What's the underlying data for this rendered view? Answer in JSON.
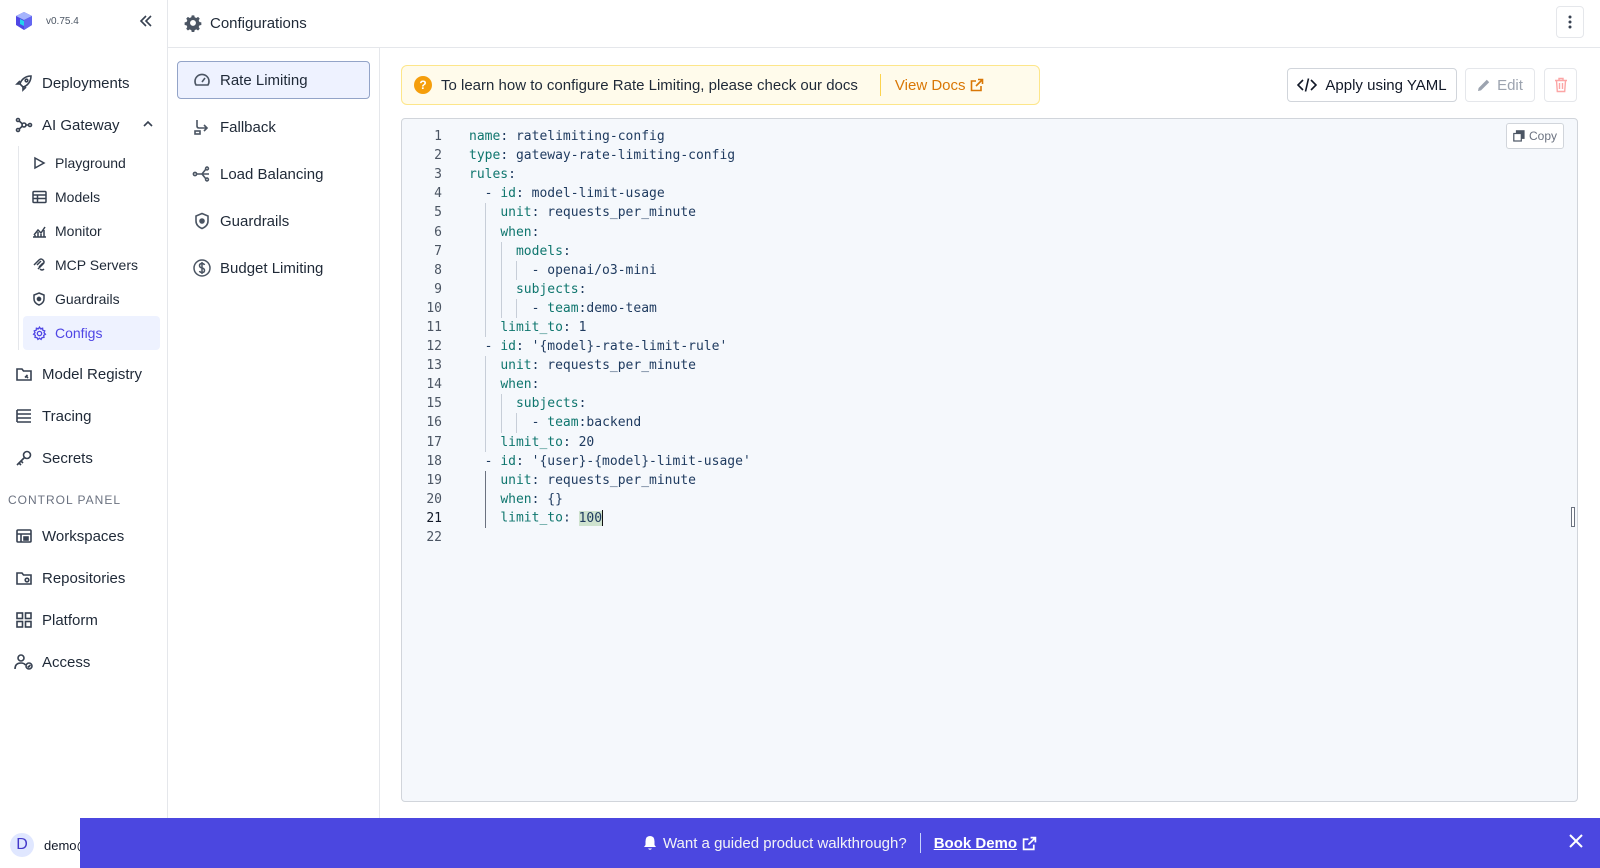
{
  "app": {
    "version": "v0.75.4"
  },
  "header": {
    "title": "Configurations"
  },
  "sidebar": {
    "top_items": [
      {
        "label": "Deployments"
      },
      {
        "label": "AI Gateway"
      }
    ],
    "ai_gateway_children": [
      {
        "label": "Playground"
      },
      {
        "label": "Models"
      },
      {
        "label": "Monitor"
      },
      {
        "label": "MCP Servers"
      },
      {
        "label": "Guardrails"
      },
      {
        "label": "Configs",
        "active": true
      }
    ],
    "mid_items": [
      {
        "label": "Model Registry"
      },
      {
        "label": "Tracing"
      },
      {
        "label": "Secrets"
      }
    ],
    "control_panel_title": "CONTROL PANEL",
    "control_items": [
      {
        "label": "Workspaces"
      },
      {
        "label": "Repositories"
      },
      {
        "label": "Platform"
      },
      {
        "label": "Access"
      }
    ],
    "user": {
      "avatar_letter": "D",
      "name": "demo@"
    }
  },
  "config_nav": [
    {
      "label": "Rate Limiting",
      "icon": "gauge-icon",
      "active": true
    },
    {
      "label": "Fallback",
      "icon": "fallback-icon"
    },
    {
      "label": "Load Balancing",
      "icon": "load-balancing-icon"
    },
    {
      "label": "Guardrails",
      "icon": "shield-icon"
    },
    {
      "label": "Budget Limiting",
      "icon": "dollar-icon"
    }
  ],
  "banner": {
    "text": "To learn how to configure Rate Limiting, please check our docs",
    "link": "View Docs"
  },
  "actions": {
    "apply_yaml": "Apply using YAML",
    "edit": "Edit"
  },
  "editor": {
    "copy_label": "Copy",
    "current_line": 21,
    "lines": [
      "name: ratelimiting-config",
      "type: gateway-rate-limiting-config",
      "rules:",
      "  - id: model-limit-usage",
      "    unit: requests_per_minute",
      "    when:",
      "      models:",
      "        - openai/o3-mini",
      "      subjects:",
      "        - team:demo-team",
      "    limit_to: 1",
      "  - id: '{model}-rate-limit-rule'",
      "    unit: requests_per_minute",
      "    when:",
      "      subjects:",
      "        - team:backend",
      "    limit_to: 20",
      "  - id: '{user}-{model}-limit-usage'",
      "    unit: requests_per_minute",
      "    when: {}",
      "    limit_to: 100",
      ""
    ]
  },
  "promo": {
    "text": "Want a guided product walkthrough?",
    "link": "Book Demo"
  },
  "colors": {
    "accent": "#4f46e5",
    "promo_bg": "#4b47e0",
    "banner_bg": "#fffbeb",
    "docs_link": "#d97706"
  }
}
